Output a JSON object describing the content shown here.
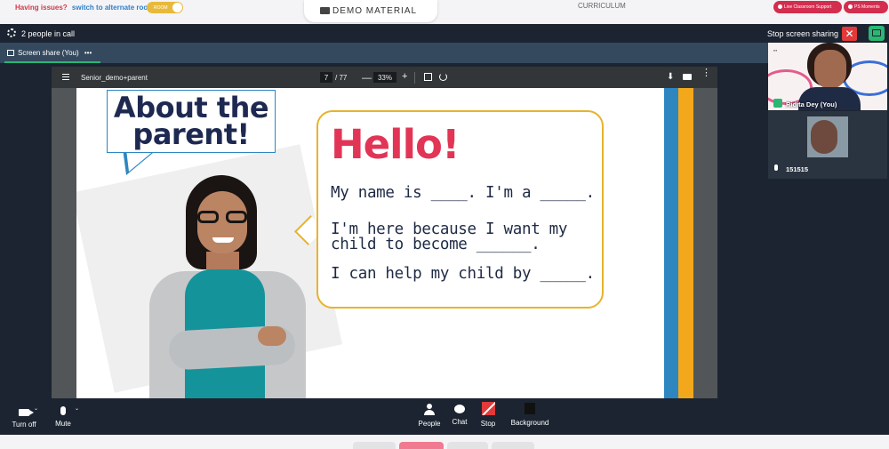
{
  "topbar": {
    "issues_text": "Having issues?",
    "switch_link": "switch to alternate room",
    "room_toggle_label": "ROOM",
    "demo_material": "DEMO MATERIAL",
    "curriculum": "CURRICULUM",
    "support_btn": "Live Classroom Support",
    "moments_btn": "PS Moments"
  },
  "call": {
    "people_count": "2 people in call",
    "stop_sharing": "Stop screen sharing",
    "close_symbol": "✕",
    "tab_label": "Screen share (You)",
    "tab_more": "•••"
  },
  "pdf": {
    "doc_name": "Senior_demo+parent",
    "page_current": "7",
    "page_total": "/ 77",
    "zoom_out": "—",
    "zoom": "33%",
    "zoom_in": "+",
    "download": "⬇",
    "more": "⋮"
  },
  "slide": {
    "about_line1": "About the",
    "about_line2": "parent!",
    "hello": "Hello!",
    "line1": "My name is ____. I'm a _____.",
    "line2": "I'm here because I want my child to become ______.",
    "line3": "I can help my child by _____."
  },
  "participants": [
    {
      "name": "Ridita Dey (You)"
    },
    {
      "name": "151515"
    }
  ],
  "controls": {
    "camera": "Turn off",
    "mic": "Mute",
    "people": "People",
    "chat": "Chat",
    "stop": "Stop",
    "background": "Background"
  },
  "colors": {
    "accent_red": "#e23556",
    "accent_green": "#2bb673",
    "call_bg": "#1c2431",
    "stripe_blue": "#2e86c1",
    "stripe_yellow": "#f3a81b",
    "bubble_border": "#e8b32c"
  }
}
